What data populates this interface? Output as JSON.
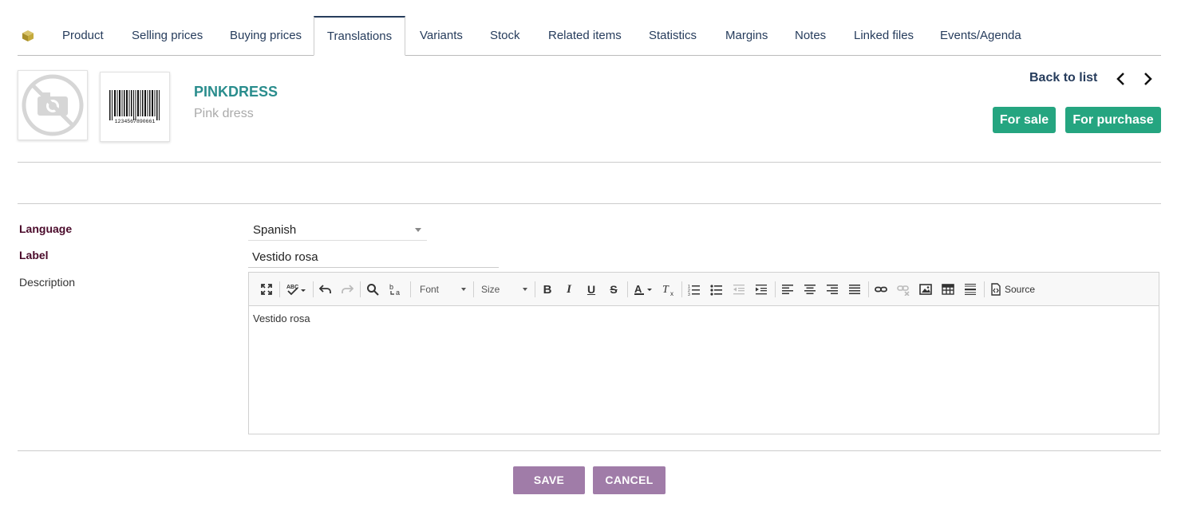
{
  "tabs": [
    {
      "label": "Product"
    },
    {
      "label": "Selling prices"
    },
    {
      "label": "Buying prices"
    },
    {
      "label": "Translations",
      "active": true
    },
    {
      "label": "Variants"
    },
    {
      "label": "Stock"
    },
    {
      "label": "Related items"
    },
    {
      "label": "Statistics"
    },
    {
      "label": "Margins"
    },
    {
      "label": "Notes"
    },
    {
      "label": "Linked files"
    },
    {
      "label": "Events/Agenda"
    }
  ],
  "product": {
    "ref": "PINKDRESS",
    "label": "Pink dress",
    "barcode_digits": "1234567890661"
  },
  "header": {
    "back_to_list": "Back to list",
    "badge_sale": "For sale",
    "badge_purchase": "For purchase"
  },
  "form": {
    "language_label": "Language",
    "language_value": "Spanish",
    "label_label": "Label",
    "label_value": "Vestido rosa",
    "description_label": "Description",
    "description_value": "Vestido rosa"
  },
  "editor": {
    "font_combo": "Font",
    "size_combo": "Size",
    "source_label": "Source"
  },
  "buttons": {
    "save": "SAVE",
    "cancel": "CANCEL"
  },
  "colors": {
    "nav_text": "#263c5c",
    "ref_teal": "#2a8d8d",
    "badge_green": "#25a580",
    "button_purple": "#a07ca8",
    "required_label": "#4a0a2a"
  }
}
